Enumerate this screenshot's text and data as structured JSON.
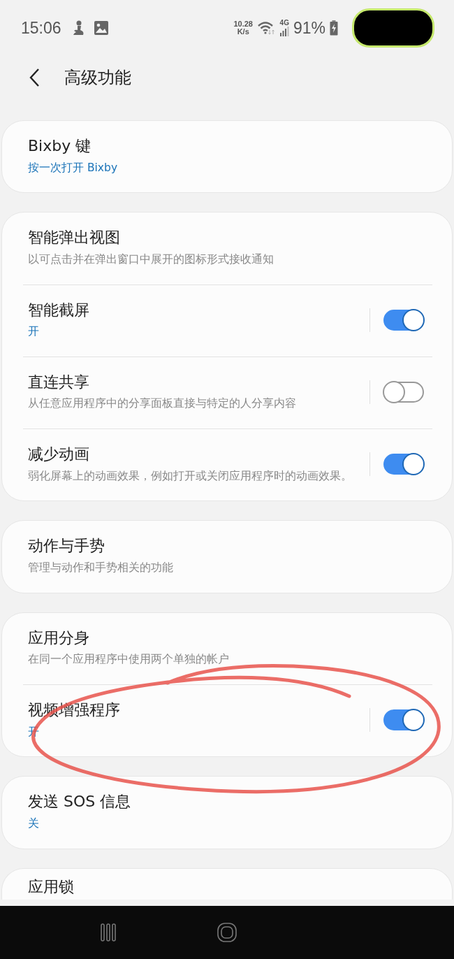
{
  "status_bar": {
    "time": "15:06",
    "speed_value": "10.28",
    "speed_unit": "K/s",
    "network": "4G",
    "battery": "91%"
  },
  "header": {
    "title": "高级功能"
  },
  "groups": [
    {
      "items": [
        {
          "kind": "link",
          "title": "Bixby 键",
          "subtitle": "按一次打开 Bixby",
          "accent": true
        }
      ]
    },
    {
      "items": [
        {
          "kind": "link",
          "title": "智能弹出视图",
          "subtitle": "以可点击并在弹出窗口中展开的图标形式接收通知",
          "accent": false
        },
        {
          "kind": "toggle",
          "title": "智能截屏",
          "subtitle": "开",
          "accent": true,
          "on": true
        },
        {
          "kind": "toggle",
          "title": "直连共享",
          "subtitle": "从任意应用程序中的分享面板直接与特定的人分享内容",
          "accent": false,
          "on": false
        },
        {
          "kind": "toggle",
          "title": "减少动画",
          "subtitle": "弱化屏幕上的动画效果，例如打开或关闭应用程序时的动画效果。",
          "accent": false,
          "on": true
        }
      ]
    },
    {
      "items": [
        {
          "kind": "link",
          "title": "动作与手势",
          "subtitle": "管理与动作和手势相关的功能",
          "accent": false
        }
      ]
    },
    {
      "items": [
        {
          "kind": "link",
          "title": "应用分身",
          "subtitle": "在同一个应用程序中使用两个单独的帐户",
          "accent": false
        },
        {
          "kind": "toggle",
          "title": "视频增强程序",
          "subtitle": "开",
          "accent": true,
          "on": true
        }
      ]
    },
    {
      "items": [
        {
          "kind": "link",
          "title": "发送 SOS 信息",
          "subtitle": "关",
          "accent": true
        }
      ]
    },
    {
      "items": [
        {
          "kind": "link",
          "title": "应用锁"
        }
      ]
    }
  ]
}
